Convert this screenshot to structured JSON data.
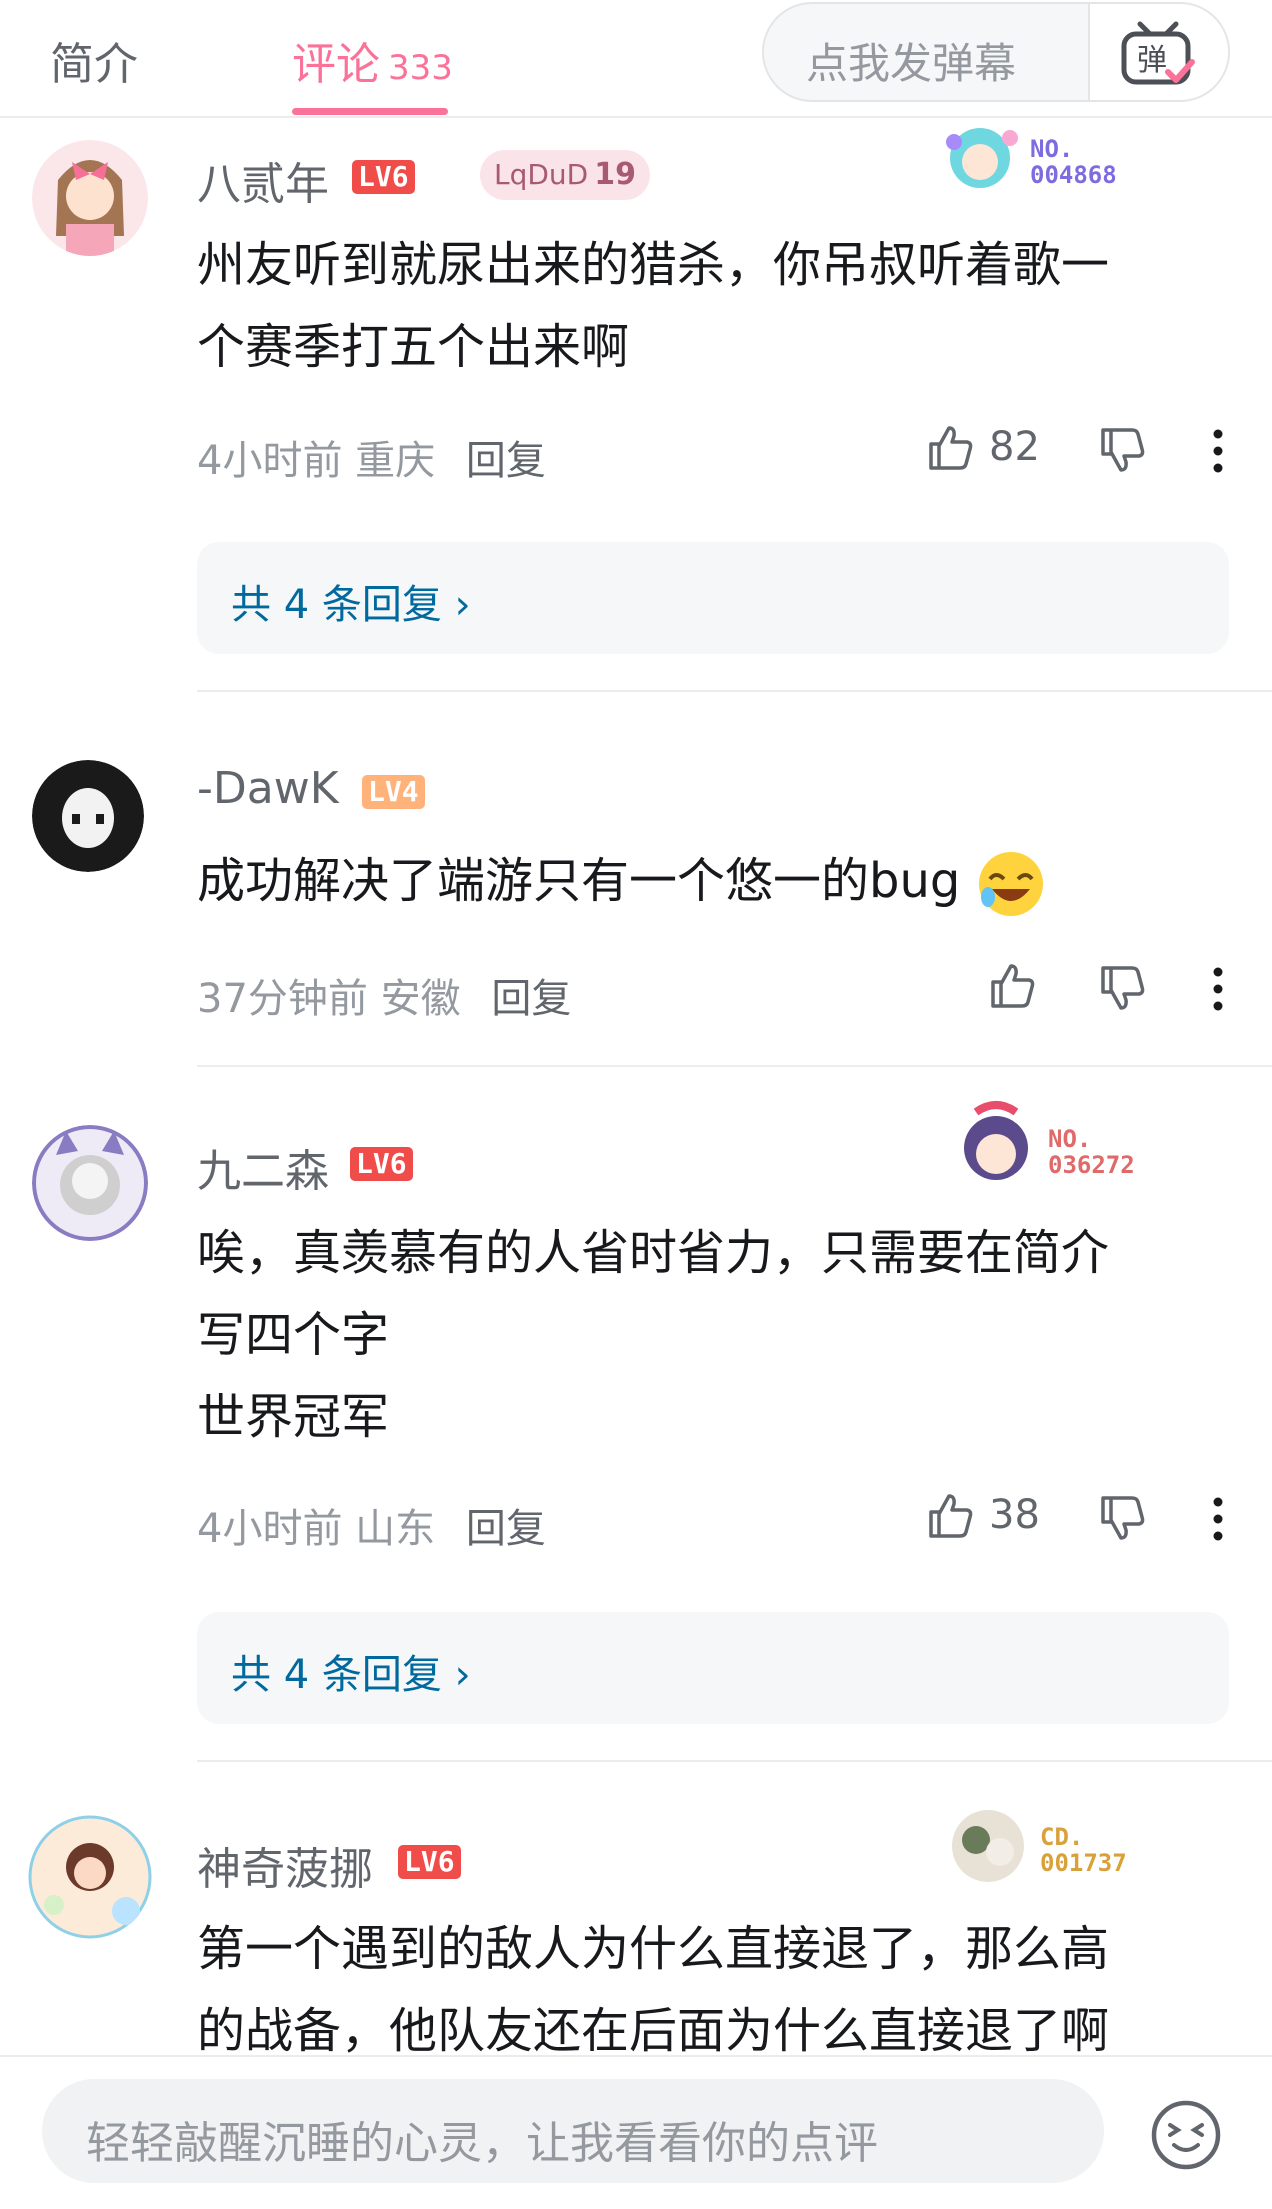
{
  "tabs": {
    "intro_label": "简介",
    "comments_label": "评论",
    "comments_count": "333"
  },
  "danmaku": {
    "placeholder": "点我发弹幕",
    "button_glyph": "弹"
  },
  "comments": [
    {
      "username": "八贰年",
      "level": "LV6",
      "fan_badge_name": "LqDuD",
      "fan_badge_level": "19",
      "decoration_no": "NO.\n004868",
      "text_lines": [
        "州友听到就尿出来的猎杀，你吊叔听着歌一",
        "个赛季打五个出来啊"
      ],
      "time": "4小时前",
      "location": "重庆",
      "reply_label": "回复",
      "likes": "82",
      "replies_label": "共 4 条回复"
    },
    {
      "username": "-DawK",
      "level": "LV4",
      "text_lines": [
        "成功解决了端游只有一个悠一的bug"
      ],
      "time": "37分钟前",
      "location": "安徽",
      "reply_label": "回复"
    },
    {
      "username": "九二森",
      "level": "LV6",
      "decoration_no": "NO.\n036272",
      "text_lines": [
        "唉，真羡慕有的人省时省力，只需要在简介",
        "写四个字",
        "世界冠军"
      ],
      "time": "4小时前",
      "location": "山东",
      "reply_label": "回复",
      "likes": "38",
      "replies_label": "共 4 条回复"
    },
    {
      "username": "神奇菠挪",
      "level": "LV6",
      "decoration_no": "CD.\n001737",
      "text_lines": [
        "第一个遇到的敌人为什么直接退了，那么高",
        "的战备，他队友还在后面为什么直接退了啊"
      ]
    }
  ],
  "bottom": {
    "input_placeholder": "轻轻敲醒沉睡的心灵，让我看看你的点评"
  },
  "colors": {
    "accent_pink": "#fb7299",
    "level_red": "#f04c49",
    "level_orange": "#ffb27a",
    "link_blue": "#00699d"
  }
}
